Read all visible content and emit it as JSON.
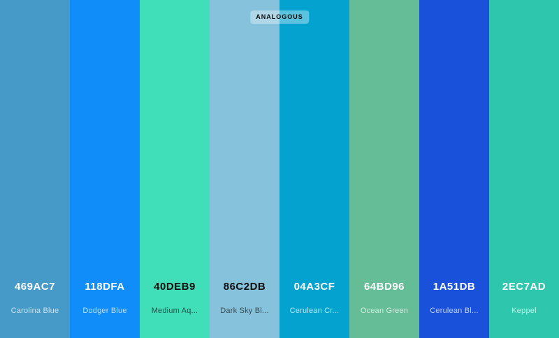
{
  "scheme": {
    "label": "ANALOGOUS"
  },
  "swatches": [
    {
      "hex": "469AC7",
      "name": "Carolina Blue",
      "color": "#469AC7",
      "text": "light"
    },
    {
      "hex": "118DFA",
      "name": "Dodger Blue",
      "color": "#118DFA",
      "text": "light"
    },
    {
      "hex": "40DEB9",
      "name": "Medium Aq...",
      "color": "#40DEB9",
      "text": "dark"
    },
    {
      "hex": "86C2DB",
      "name": "Dark Sky Bl...",
      "color": "#86C2DB",
      "text": "dark"
    },
    {
      "hex": "04A3CF",
      "name": "Cerulean Cr...",
      "color": "#04A3CF",
      "text": "light"
    },
    {
      "hex": "64BD96",
      "name": "Ocean Green",
      "color": "#64BD96",
      "text": "light"
    },
    {
      "hex": "1A51DB",
      "name": "Cerulean Bl...",
      "color": "#1A51DB",
      "text": "light"
    },
    {
      "hex": "2EC7AD",
      "name": "Keppel",
      "color": "#2EC7AD",
      "text": "light"
    }
  ]
}
